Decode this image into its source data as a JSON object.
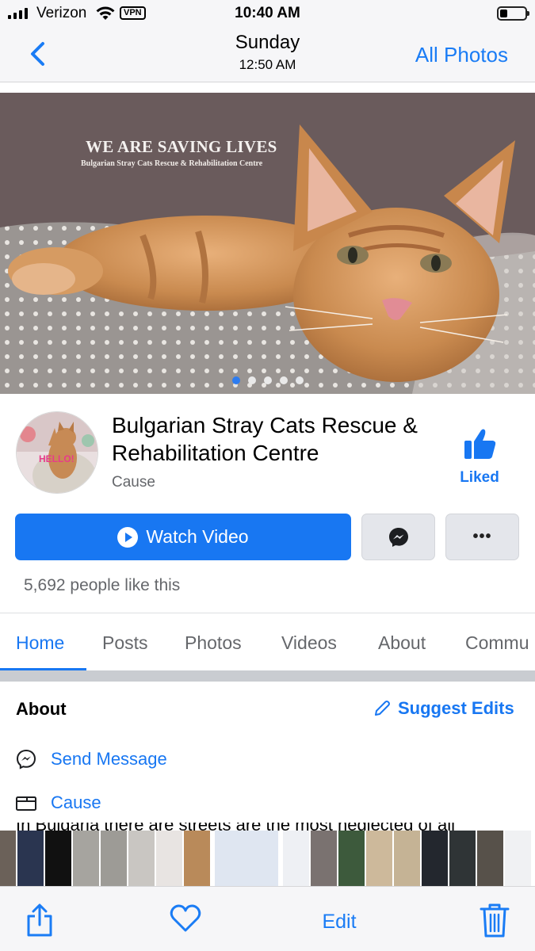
{
  "status_bar": {
    "carrier": "Verizon",
    "vpn": "VPN",
    "time": "10:40 AM"
  },
  "photos_nav": {
    "date": "Sunday",
    "time": "12:50 AM",
    "all_photos": "All Photos",
    "back_icon": "chevron-left-icon"
  },
  "cover": {
    "title": "WE ARE SAVING LIVES",
    "subtitle": "Bulgarian Stray Cats Rescue & Rehabilitation Centre",
    "slide_count": 5,
    "active_slide": 1
  },
  "page": {
    "avatar_text": "HELLO!",
    "name": "Bulgarian Stray Cats Rescue & Rehabilitation Centre",
    "category": "Cause",
    "liked_label": "Liked",
    "watch_video_label": "Watch Video",
    "more_label": "•••",
    "likes_text": "5,692 people like this"
  },
  "tabs": [
    "Home",
    "Posts",
    "Photos",
    "Videos",
    "About",
    "Commu"
  ],
  "about": {
    "heading": "About",
    "suggest_edits": "Suggest Edits",
    "send_message": "Send Message",
    "category": "Cause",
    "truncated_text": "In Bulgaria there are streets are the most neglected of all"
  },
  "toolbar": {
    "edit_label": "Edit"
  },
  "colors": {
    "fb_blue": "#1877f2",
    "ios_blue": "#1a7cf5",
    "gray_text": "#65676b"
  }
}
